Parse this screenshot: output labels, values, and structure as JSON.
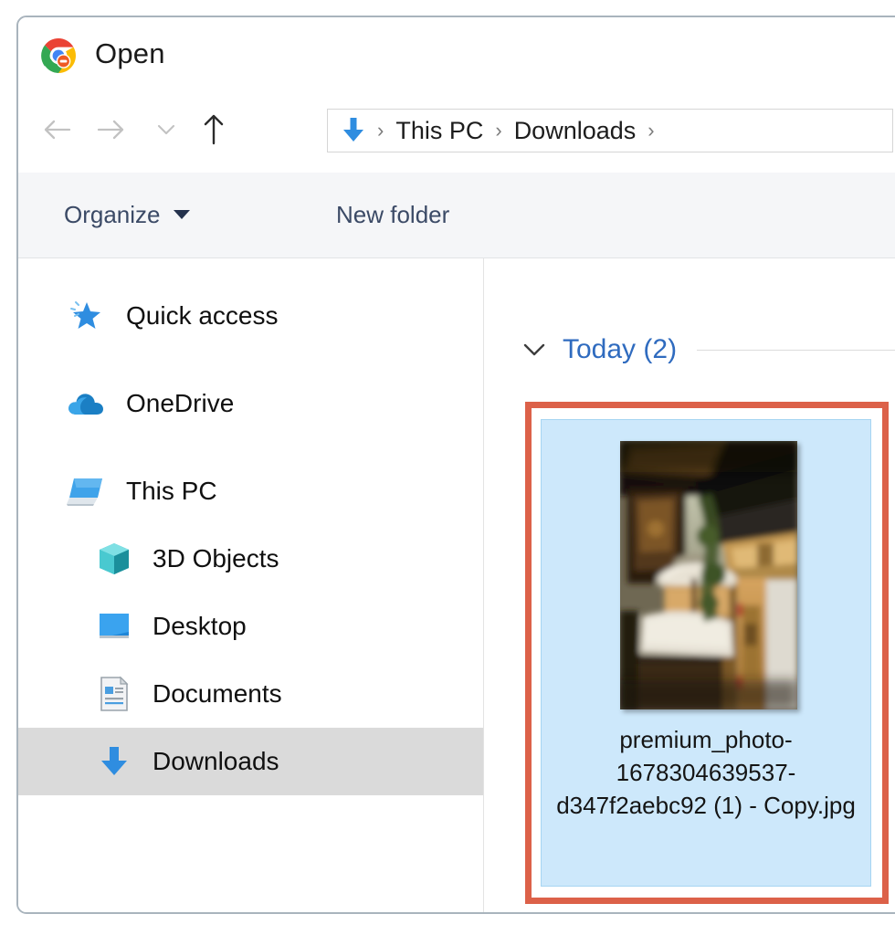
{
  "window": {
    "title": "Open",
    "app_icon": "chrome-icon"
  },
  "navigation": {
    "back_icon": "arrow-left-icon",
    "forward_icon": "arrow-right-icon",
    "recent_icon": "chevron-down-icon",
    "up_icon": "arrow-up-icon",
    "address_bar": {
      "folder_icon": "downloads-arrow-icon",
      "crumbs": [
        "This PC",
        "Downloads"
      ],
      "separator": "›",
      "trailing_separator": "›"
    }
  },
  "toolbar": {
    "organize_label": "Organize",
    "organize_caret_icon": "caret-down-icon",
    "new_folder_label": "New folder"
  },
  "nav_pane": {
    "items": [
      {
        "label": "Quick access",
        "icon": "star-pin-icon",
        "depth": 0,
        "selected": false
      },
      {
        "label": "OneDrive",
        "icon": "cloud-icon",
        "depth": 0,
        "selected": false
      },
      {
        "label": "This PC",
        "icon": "monitor-icon",
        "depth": 0,
        "selected": false
      },
      {
        "label": "3D Objects",
        "icon": "cube-icon",
        "depth": 1,
        "selected": false
      },
      {
        "label": "Desktop",
        "icon": "desktop-icon",
        "depth": 1,
        "selected": false
      },
      {
        "label": "Documents",
        "icon": "document-icon",
        "depth": 1,
        "selected": false
      },
      {
        "label": "Downloads",
        "icon": "download-arrow-icon",
        "depth": 1,
        "selected": true
      }
    ]
  },
  "file_pane": {
    "group": {
      "chevron_icon": "chevron-down-icon",
      "label": "Today (2)"
    },
    "selected_file": {
      "name": "premium_photo-1678304639537-d347f2aebc92 (1) - Copy.jpg",
      "thumbnail_alt": "thatched-roof hut with white parasol"
    }
  },
  "colors": {
    "annotation_red": "#dc6149",
    "selection_blue": "#cde8fb",
    "selection_border": "#a6d5f2",
    "group_header_blue": "#2f6bbf",
    "nav_selected_grey": "#dadada",
    "window_border": "#a9b4bd",
    "toolbar_bg": "#f5f6f8"
  }
}
